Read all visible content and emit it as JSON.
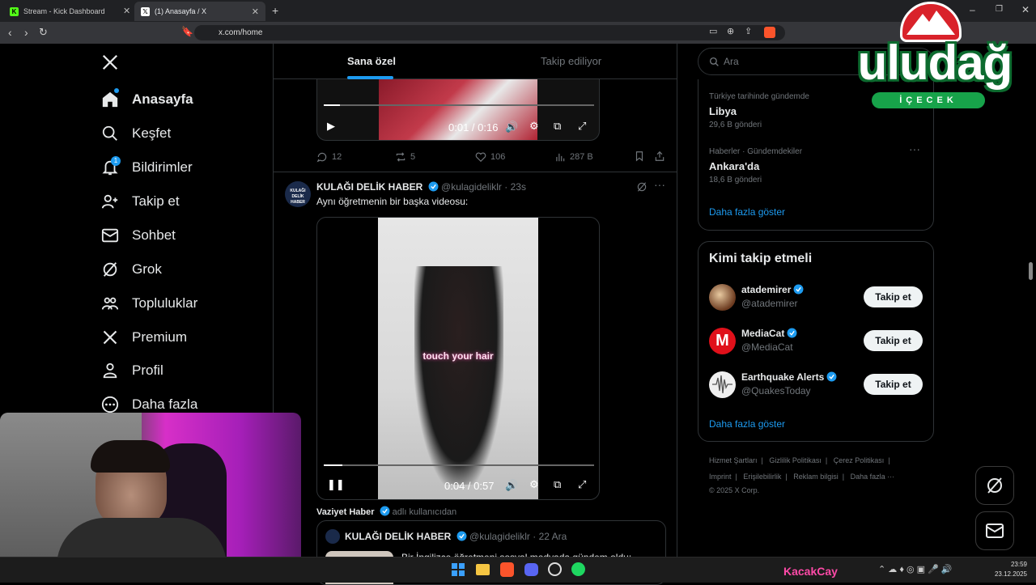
{
  "browser": {
    "tabs": [
      {
        "title": "Stream - Kick Dashboard",
        "favicon": "kick-icon",
        "active": false
      },
      {
        "title": "(1) Anasayfa / X",
        "favicon": "x-icon",
        "active": true
      }
    ],
    "url": "x.com/home"
  },
  "sidebar": {
    "items": [
      {
        "label": "Anasayfa",
        "icon": "home-icon"
      },
      {
        "label": "Keşfet",
        "icon": "search-icon"
      },
      {
        "label": "Bildirimler",
        "icon": "bell-icon",
        "badge": "1"
      },
      {
        "label": "Takip et",
        "icon": "add-user-icon"
      },
      {
        "label": "Sohbet",
        "icon": "mail-icon"
      },
      {
        "label": "Grok",
        "icon": "grok-icon"
      },
      {
        "label": "Topluluklar",
        "icon": "communities-icon"
      },
      {
        "label": "Premium",
        "icon": "x-icon"
      },
      {
        "label": "Profil",
        "icon": "profile-icon"
      },
      {
        "label": "Daha fazla",
        "icon": "more-icon"
      }
    ]
  },
  "feed": {
    "tabs": [
      "Sana özel",
      "Takip ediliyor"
    ],
    "video1": {
      "time": "0:01 / 0:16",
      "progress": 0.06
    },
    "stats1": {
      "replies": "12",
      "reposts": "5",
      "likes": "106",
      "views": "287 B"
    },
    "post2": {
      "name": "KULAĞI DELİK HABER",
      "handle": "@kulagideliklr",
      "time": "· 23s",
      "text": "Aynı öğretmenin bir başka videosu:",
      "avatar_text": "KULAĞI DELİK HABER",
      "video_caption": "touch your hair",
      "video_time": "0:04 / 0:57",
      "progress": 0.07
    },
    "repost_source": {
      "name": "Vaziyet Haber",
      "suffix": "adlı kullanıcıdan"
    },
    "quoted": {
      "name": "KULAĞI DELİK HABER",
      "handle": "@kulagideliklr",
      "time": "· 22 Ara",
      "text": "Bir İngilizce öğretmeni sosyal medyada gündem oldu:"
    }
  },
  "right": {
    "search_placeholder": "Ara",
    "trends": [
      {
        "context": "Türkiye tarihinde gündemde",
        "title": "Libya",
        "count": "29,6 B gönderi"
      },
      {
        "context": "Haberler · Gündemdekiler",
        "title": "Ankara'da",
        "count": "18,6 B gönderi"
      }
    ],
    "trends_more": "Daha fazla göster",
    "who_to_follow": {
      "title": "Kimi takip etmeli",
      "accounts": [
        {
          "name": "atademirer",
          "handle": "@atademirer"
        },
        {
          "name": "MediaCat",
          "handle": "@MediaCat"
        },
        {
          "name": "Earthquake Alerts",
          "handle": "@QuakesToday"
        }
      ],
      "button": "Takip et",
      "more": "Daha fazla göster"
    },
    "footer": {
      "links1": [
        "Hizmet Şartları",
        "Gizlilik Politikası",
        "Çerez Politikası"
      ],
      "links2": [
        "Imprint",
        "Erişilebilirlik",
        "Reklam bilgisi",
        "Daha fazla ···"
      ],
      "copyright": "© 2025 X Corp."
    }
  },
  "overlay": {
    "brand_top": "uludağ",
    "brand_bottom": "İÇECEK"
  },
  "taskbar": {
    "stream_user": "KacakCay",
    "time": "23:59",
    "date": "23.12.2025"
  },
  "colors": {
    "accent": "#1d9bf0",
    "background": "#000000",
    "border": "#2f3336"
  }
}
